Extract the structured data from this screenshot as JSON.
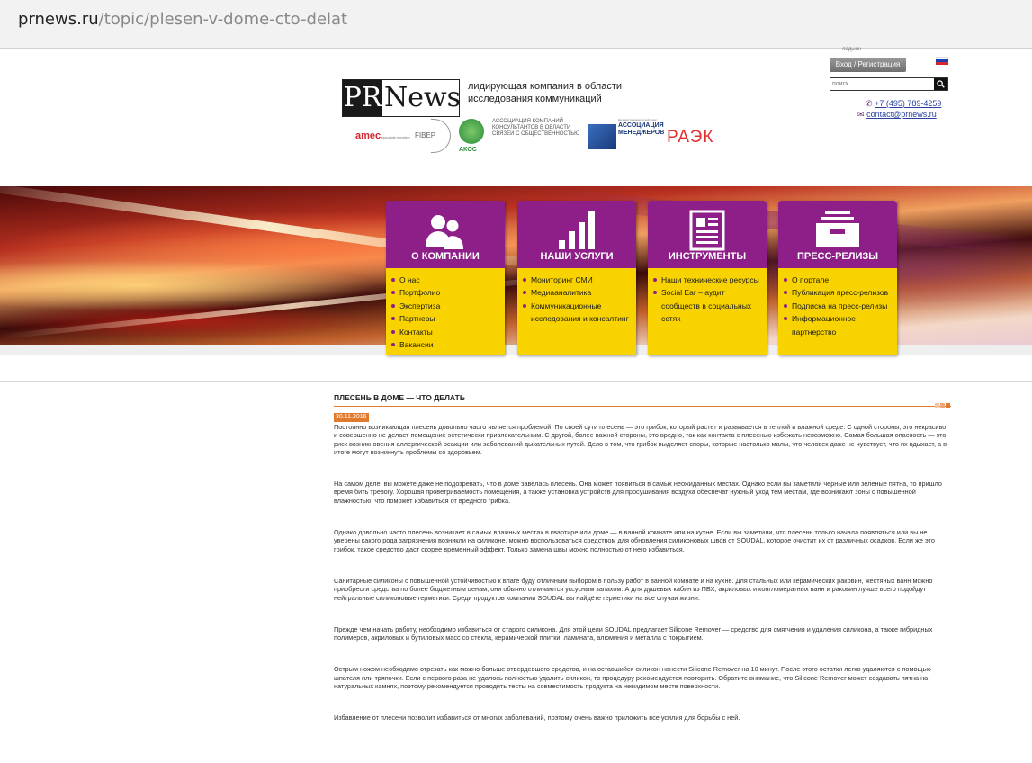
{
  "browser": {
    "url_domain": "prnews.ru",
    "url_path": "/topic/plesen-v-dome-cto-delat"
  },
  "header": {
    "top_link": "ладынн",
    "login_label": "Вход / Регистрация",
    "search_placeholder": "поиск",
    "phone": "+7 (495) 789-4259",
    "email": "contact@prnews.ru",
    "logo_pr": "PR",
    "logo_news": "News",
    "tagline": "лидирующая компания в области исследования коммуникаций",
    "partners": {
      "amec": "amec",
      "amec_sub": "associate member",
      "fibep": "FIBEP",
      "akos": "АКОС",
      "akos_text": "АССОЦИАЦИЯ КОМПАНИЙ-КОНСУЛЬТАНТОВ В ОБЛАСТИ СВЯЗЕЙ С ОБЩЕСТВЕННОСТЬЮ",
      "am_small": "Деловой Академический Совет",
      "am_text": "АССОЦИАЦИЯ МЕНЕДЖЕРОВ",
      "raek": "РАЭК"
    }
  },
  "menu": [
    {
      "title": "О КОМПАНИИ",
      "icon": "people-icon",
      "items": [
        "О нас",
        "Портфолио",
        "Экспертиза",
        "Партнеры",
        "Контакты",
        "Вакансии"
      ]
    },
    {
      "title": "НАШИ УСЛУГИ",
      "icon": "bar-chart-icon",
      "items": [
        "Мониторинг СМИ",
        "Медиааналитика",
        "Коммуникационные",
        "исследования и консалтинг"
      ]
    },
    {
      "title": "ИНСТРУМЕНТЫ",
      "icon": "document-icon",
      "items": [
        "Наши технические ресурсы",
        "Social Ear – аудит",
        "сообществ в социальных",
        "сетях"
      ]
    },
    {
      "title": "ПРЕСС-РЕЛИЗЫ",
      "icon": "tray-icon",
      "items": [
        "О портале",
        "Публикация пресс-релизов",
        "Подписка на пресс-релизы",
        "Информационное",
        "партнерство"
      ]
    }
  ],
  "article": {
    "title": "ПЛЕСЕНЬ В ДОМЕ — ЧТО ДЕЛАТЬ",
    "date": "30.11.2016",
    "paragraphs": [
      "Постоянно возникающая плесень довольно часто является проблемой. По своей сути плесень — это грибок, который растет и развивается в теплой и влажной среде. С одной стороны, это некрасиво и совершенно не делает помещение эстетически привлекательным. С другой, более важной стороны, это вредно, так как контакта с плесенью избежать невозможно. Самая большая опасность — это риск возникновения аллергической реакции или заболеваний дыхательных путей. Дело в том, что грибок выделяет споры, которые настолько малы, что человек даже не чувствует, что их вдыхает, а в итоге могут возникнуть проблемы со здоровьем.",
      "На самом деле, вы можете даже не подозревать, что в доме завелась плесень. Она может появиться в самых неожиданных местах. Однако если вы заметили черные или зеленые пятна, то пришло время бить тревогу. Хорошая проветриваемость помещения, а также установка устройств для просушивания воздуха обеспечат нужный уход тем местам, где возникают зоны с повышенной влажностью, что поможет избавиться от вредного грибка.",
      "Однако довольно часто плесень возникает в самых влажных местах в квартире или доме — в ванной комнате или на кухне. Если вы заметили, что плесень только начала появляться или вы не уверены какого рода загрязнения возникли на силиконе, можно воспользоваться средством для обновления силиконовых швов от SOUDAL, которое очистит их от различных осадков. Если же это грибок, такое средство даст скорее временный эффект. Только замена швы можно полностью от него избавиться.",
      "Санитарные силиконы с повышенной устойчивостью к влаге буду отличным выбором в пользу работ в ванной комнате и на кухне. Для стальных или керамических раковин, жестяных ванн можно приобрести средства по более бюджетным ценам, они обычно отличаются уксусным запахом. А для душевых кабин из ПВХ, акриловых и конгломератных ванн и раковин лучше всего подойдут нейтральные силиконовые герметики. Среди продуктов компании SOUDAL вы найдёте герметики на все случаи жизни.",
      "Прежде чем начать работу, необходимо избавиться от старого силикона. Для этой цели SOUDAL предлагает Silicone Remover — средство для смягчения и удаления силикона, а также гибридных полимеров, акриловых и бутиловых масс со стекла, керамической плитки, ламината, алюминия и металла с покрытием.",
      "Острым ножом необходимо отрезать как можно больше отвердевшего средства, и на оставшийся силикон нанести Silicone Remover на 10 минут. После этого остатки легко удаляются с помощью шпателя или тряпочки. Если с первого раза не удалось полностью удалить силикон, то процедуру рекомендуется повторить. Обратите внимание, что Silicone Remover может создавать пятна на натуральных камнях, поэтому рекомендуется проводить тесты на совместимость продукта на невидимом месте поверхности.",
      "Избавление от плесени позволит избавиться от многих заболеваний, поэтому очень важно приложить все усилия для борьбы с ней."
    ]
  },
  "colors": {
    "purple": "#8e1f88",
    "yellow": "#f8d300",
    "orange": "#e07a2e"
  }
}
